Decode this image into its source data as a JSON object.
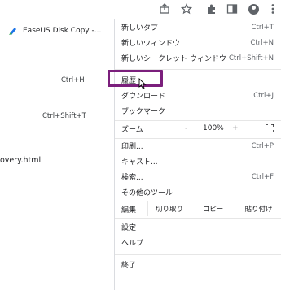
{
  "toolbar": {
    "icons": [
      "share-icon",
      "star-icon",
      "extension-icon",
      "sidebar-icon",
      "profile-icon",
      "more-icon"
    ]
  },
  "page": {
    "tab_title": "EaseUS Disk Copy -...",
    "shortcut_history": "Ctrl+H",
    "shortcut_reopen": "Ctrl+Shift+T",
    "file_text": "overy.html"
  },
  "menu": {
    "new_tab": {
      "label": "新しいタブ",
      "shortcut": "Ctrl+T"
    },
    "new_window": {
      "label": "新しいウィンドウ",
      "shortcut": "Ctrl+N"
    },
    "new_incognito": {
      "label": "新しいシークレット ウィンドウ",
      "shortcut": "Ctrl+Shift+N"
    },
    "history": {
      "label": "履歴"
    },
    "downloads": {
      "label": "ダウンロード",
      "shortcut": "Ctrl+J"
    },
    "bookmarks": {
      "label": "ブックマーク"
    },
    "zoom": {
      "label": "ズーム",
      "minus": "-",
      "value": "100%",
      "plus": "+"
    },
    "print": {
      "label": "印刷...",
      "shortcut": "Ctrl+P"
    },
    "cast": {
      "label": "キャスト..."
    },
    "find": {
      "label": "検索...",
      "shortcut": "Ctrl+F"
    },
    "more_tools": {
      "label": "その他のツール"
    },
    "edit": {
      "label": "編集",
      "cut": "切り取り",
      "copy": "コピー",
      "paste": "貼り付け"
    },
    "settings": {
      "label": "設定"
    },
    "help": {
      "label": "ヘルプ"
    },
    "exit": {
      "label": "終了"
    }
  },
  "colors": {
    "highlight": "#7b1f7c",
    "icon": "#5f6368"
  }
}
